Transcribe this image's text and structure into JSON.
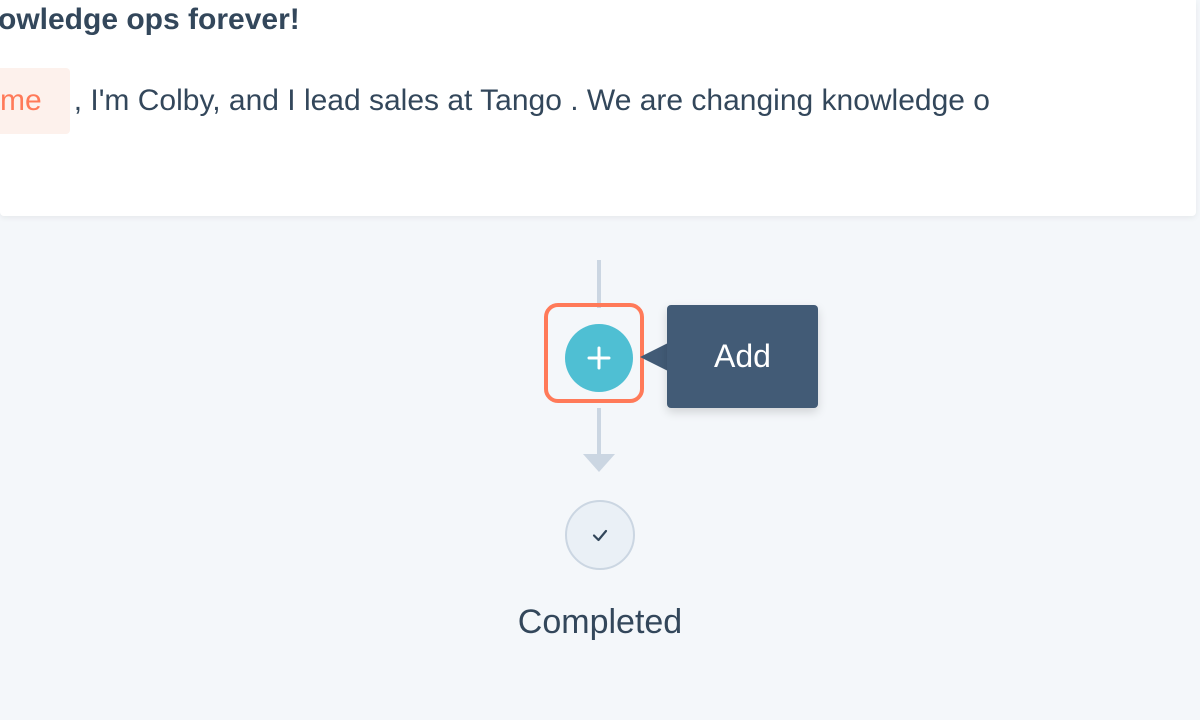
{
  "email": {
    "subject": "owledge ops forever!",
    "token_chip": "me",
    "body_text": ", I'm Colby, and I lead sales at Tango . We are changing knowledge o"
  },
  "flow": {
    "add_button_icon": "plus-icon",
    "tooltip_label": "Add",
    "completed_icon": "check-icon",
    "completed_label": "Completed"
  },
  "colors": {
    "accent_teal": "#4fbfd3",
    "highlight_orange": "#ff7a59",
    "tooltip_bg": "#425b76",
    "text_primary": "#33475b",
    "connector": "#cbd6e2",
    "canvas_bg": "#f4f7fa"
  }
}
